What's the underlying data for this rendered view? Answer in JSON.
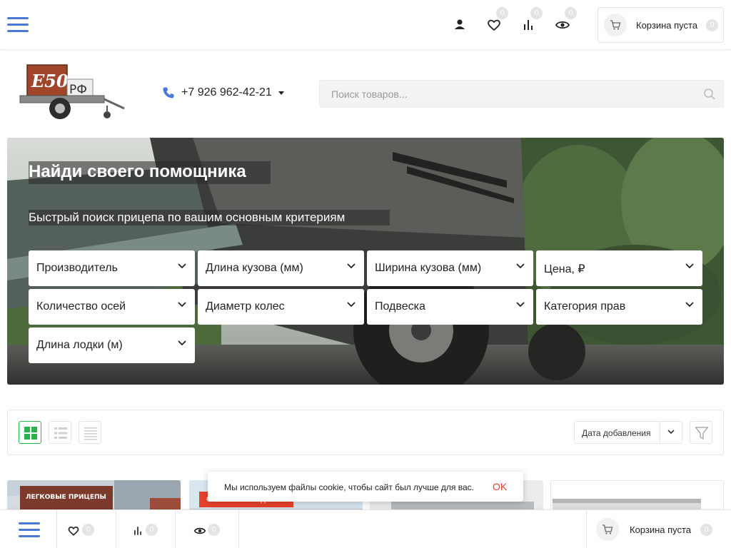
{
  "header": {
    "badges": {
      "favorites": "0",
      "compare": "0",
      "viewed": "0"
    },
    "cart_label": "Корзина пуста",
    "cart_count": "0",
    "icons": [
      "menu-icon",
      "user-icon",
      "heart-icon",
      "compare-icon",
      "eye-icon",
      "cart-icon"
    ]
  },
  "logo": {
    "line1": "E50",
    "line2": "РФ"
  },
  "contact": {
    "phone": "+7 926 962-42-21"
  },
  "search": {
    "placeholder": "Поиск товаров..."
  },
  "hero": {
    "title": "Найди своего помощника",
    "subtitle": "Быстрый поиск прицепа по вашим основным критериям",
    "filters": [
      "Производитель",
      "Длина кузова (мм)",
      "Ширина кузова (мм)",
      "Цена, ₽",
      "Количество осей",
      "Диаметр колес",
      "Подвеска",
      "Категория прав",
      "Длина лодки (м)"
    ]
  },
  "toolbar": {
    "sort_label": "Дата добавления",
    "view_modes": [
      "grid",
      "list",
      "table"
    ],
    "active_view": "grid"
  },
  "products": {
    "card1_banner": "ЛЕГКОВЫЕ ПРИЦЕПЫ",
    "card2_badge": "Особенная скидка"
  },
  "cookie": {
    "text": "Мы используем файлы cookie, чтобы сайт был лучше для вас.",
    "ok": "OK"
  },
  "bottom": {
    "favorites": "0",
    "compare": "0",
    "viewed": "0",
    "cart_label": "Корзина пуста",
    "cart_count": "0"
  },
  "colors": {
    "accent": "#4a78d9",
    "green": "#2bb24c",
    "red": "#e8412c"
  }
}
